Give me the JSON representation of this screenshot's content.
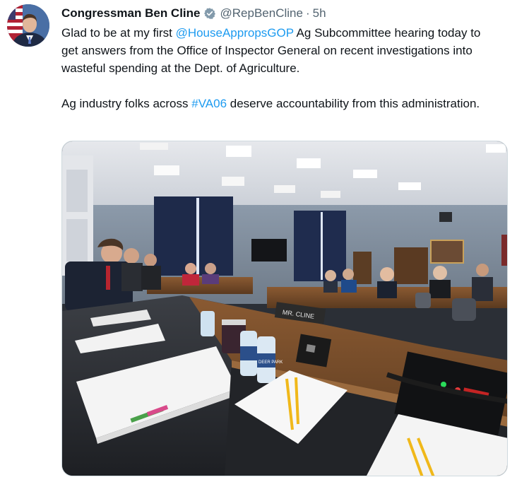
{
  "author": {
    "name": "Congressman Ben Cline",
    "handle": "@RepBenCline",
    "separator": "·",
    "time": "5h",
    "verified": true
  },
  "tweet": {
    "p1_start": "Glad to be at my first ",
    "mention": "@HouseAppropsGOP",
    "p1_end": " Ag Subcommittee hearing today to get answers from the Office of Inspector General on recent investigations into wasteful spending at the Dept. of Agriculture.",
    "p2_start": "Ag industry folks across ",
    "hashtag": "#VA06",
    "p2_end": " deserve accountability from this administration."
  },
  "media": {
    "nameplate": "MR. CLINE",
    "water_label": "DEER PARK"
  },
  "colors": {
    "link": "#1d9bf0",
    "verified_badge": "#829aab",
    "text": "#0f1419",
    "muted": "#536471"
  },
  "icons": {
    "verified": "verified-badge-icon"
  }
}
